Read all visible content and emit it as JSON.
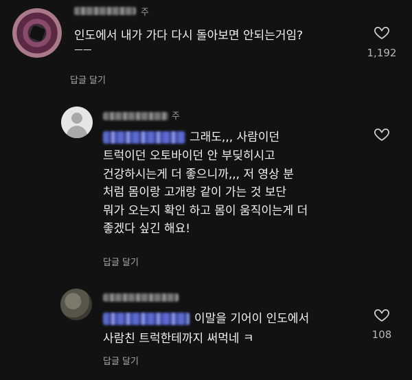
{
  "comments": [
    {
      "time": "주",
      "text": "인도에서 내가 가다 다시 돌아보면 안되는거임?",
      "text2": "ㅡㅡ",
      "reply_label": "답글 달기",
      "likes": "1,192"
    },
    {
      "time": "주",
      "text_line1": "그래도,,, 사람이던",
      "text_rest": "트럭이던 오토바이던 안 부딪히시고\n건강하시는게 더 좋으니까,,, 저 영상 분\n처럼 몸이랑 고개랑 같이 가는 것 보단\n뭐가 오는지 확인 하고 몸이 움직이는게 더\n좋겠다 싶긴 해요!",
      "reply_label": "답글 달기",
      "likes": ""
    },
    {
      "time": "",
      "text_line1": "이말을 기어이 인도에서",
      "text_rest": "사람친 트럭한테까지 써먹네 ㅋ",
      "reply_label": "답글 달기",
      "likes": "108"
    }
  ],
  "icons": {
    "like": "heart-outline-icon"
  }
}
